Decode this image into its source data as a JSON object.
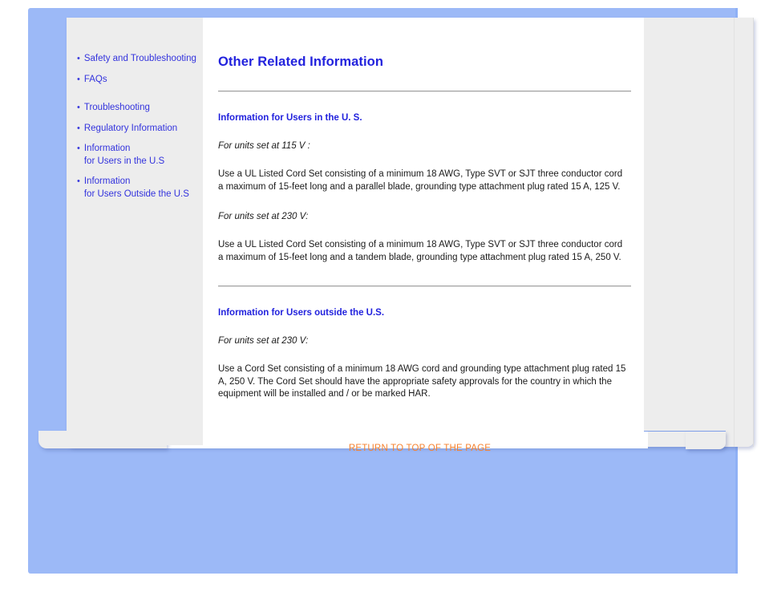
{
  "sidebar": {
    "groups": [
      {
        "items": [
          {
            "label": "Safety and Troubleshooting",
            "name": "sidebar-link-safety-and-troubleshooting"
          },
          {
            "label": "FAQs",
            "name": "sidebar-link-faqs"
          }
        ]
      },
      {
        "items": [
          {
            "label": "Troubleshooting",
            "name": "sidebar-link-troubleshooting"
          },
          {
            "label": "Regulatory Information",
            "name": "sidebar-link-regulatory-information"
          },
          {
            "label": "Information",
            "label2": "for Users in the U.S",
            "name": "sidebar-link-information-for-users-in-the-us"
          },
          {
            "label": "Information",
            "label2": "for Users Outside the U.S",
            "name": "sidebar-link-information-for-users-outside-the-us"
          }
        ]
      }
    ]
  },
  "content": {
    "title": "Other Related Information",
    "section_us": {
      "heading": "Information for Users in the U. S.",
      "italic_115": "For units set at 115 V :",
      "para_115": "Use a UL Listed Cord Set consisting of a minimum 18 AWG, Type SVT or SJT three conductor cord a maximum of 15-feet long and a parallel blade, grounding type attachment plug rated 15 A, 125 V.",
      "italic_230": "For units set at 230 V:",
      "para_230": "Use a UL Listed Cord Set consisting of a minimum 18 AWG, Type SVT or SJT three conductor cord a maximum of 15-feet long and a tandem blade, grounding type attachment plug rated 15 A, 250 V."
    },
    "section_outside_us": {
      "heading": "Information for Users outside the U.S.",
      "italic_230": "For units set at 230 V:",
      "para_230": "Use a Cord Set consisting of a minimum 18 AWG cord and grounding type attachment plug rated 15 A, 250 V. The Cord Set should have the appropriate safety approvals for the country in which the equipment will be installed and / or be marked HAR."
    },
    "return_to_top": "RETURN TO TOP OF THE PAGE"
  },
  "colors": {
    "page_blue": "#9cb9f7",
    "link_blue": "#3333dd",
    "heading_blue": "#2222dd",
    "sidebar_grey": "#ededed",
    "return_orange": "#f5812f",
    "rule_grey": "#9a9a9a"
  }
}
